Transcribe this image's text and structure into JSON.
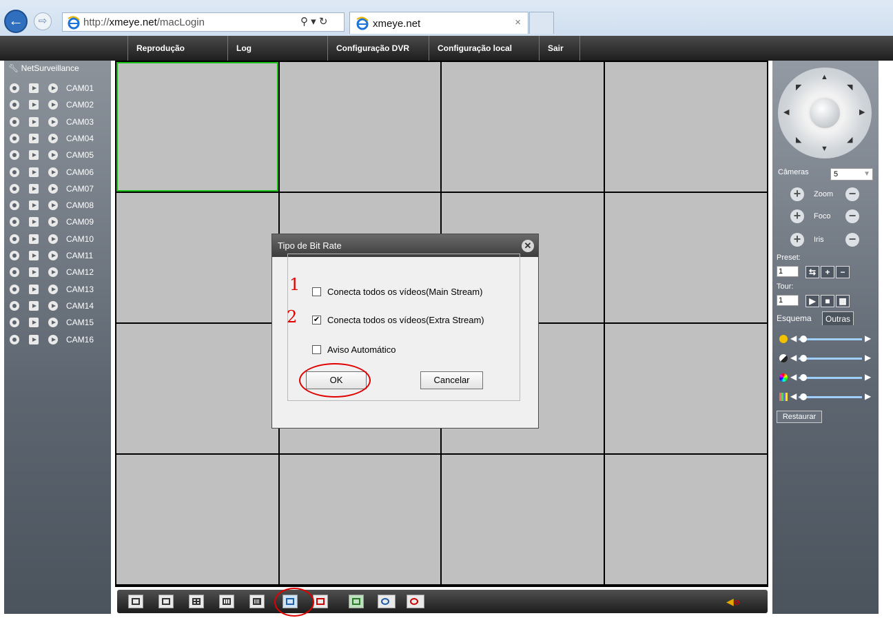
{
  "browser": {
    "address_prefix": "http://",
    "address_host": "xmeye.net",
    "address_path": "/macLogin",
    "search_controls": "⚲ ▾ ↻",
    "tab_title": "xmeye.net",
    "tab_close": "×"
  },
  "menu": {
    "items": [
      "Reprodução",
      "Log",
      "Configuração DVR",
      "Configuração local",
      "Sair"
    ]
  },
  "sidebar": {
    "root_label": "NetSurveillance",
    "cameras": [
      "CAM01",
      "CAM02",
      "CAM03",
      "CAM04",
      "CAM05",
      "CAM06",
      "CAM07",
      "CAM08",
      "CAM09",
      "CAM10",
      "CAM11",
      "CAM12",
      "CAM13",
      "CAM14",
      "CAM15",
      "CAM16"
    ]
  },
  "ptz": {
    "cameras_label": "Câmeras",
    "cameras_value": "5",
    "zoom_label": "Zoom",
    "focus_label": "Foco",
    "iris_label": "Iris",
    "preset_label": "Preset:",
    "preset_value": "1",
    "tour_label": "Tour:",
    "tour_value": "1",
    "tab_scheme": "Esquema",
    "tab_other": "Outras",
    "restore_label": "Restaurar"
  },
  "dialog": {
    "title": "Tipo de Bit Rate",
    "option_main": "Conecta todos os vídeos(Main Stream)",
    "option_main_checked": false,
    "option_extra": "Conecta todos os vídeos(Extra Stream)",
    "option_extra_checked": true,
    "option_auto": "Aviso Automático",
    "option_auto_checked": false,
    "ok_label": "OK",
    "cancel_label": "Cancelar"
  },
  "annotations": {
    "mark_1": "1",
    "mark_2": "2"
  },
  "colors": {
    "active_cell": "#18c018",
    "annotation": "#e00000"
  }
}
